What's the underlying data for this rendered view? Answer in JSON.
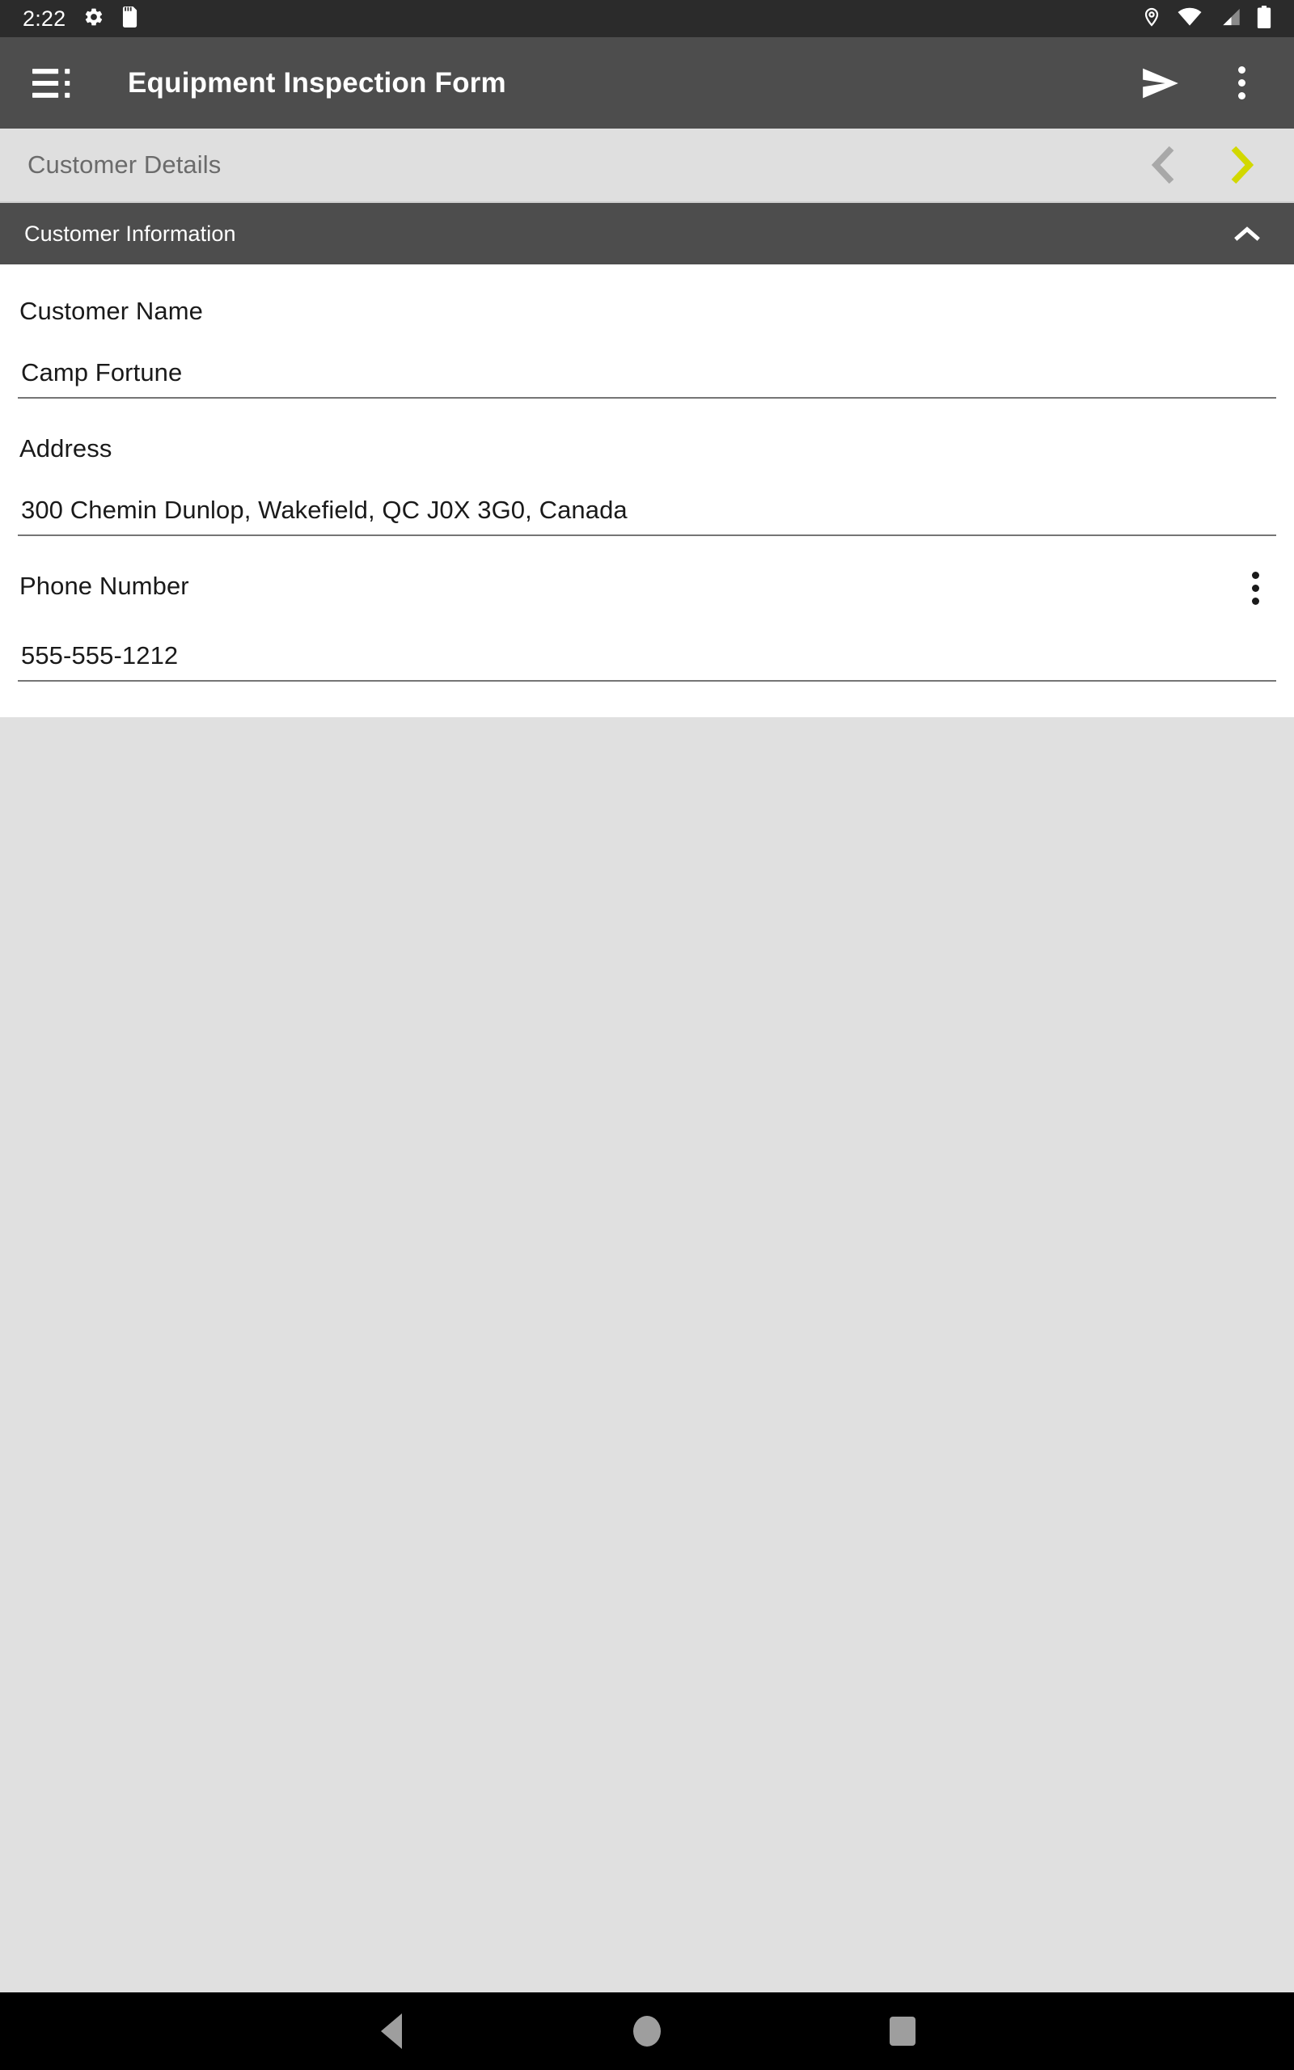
{
  "status_bar": {
    "time": "2:22",
    "left_icons": [
      "settings-gear-icon",
      "sd-card-icon"
    ],
    "right_icons": [
      "location-pin-icon",
      "wifi-icon",
      "cellular-signal-icon",
      "battery-icon"
    ],
    "background_color": "#2b2b2b"
  },
  "app_bar": {
    "menu_icon": "list-menu-icon",
    "title": "Equipment Inspection Form",
    "actions": [
      "send-icon",
      "overflow-menu-icon"
    ],
    "background_color": "#4d4d4d"
  },
  "page_nav": {
    "title": "Customer Details",
    "prev_label": "Previous page",
    "next_label": "Next page",
    "prev_enabled": false,
    "next_enabled": true,
    "prev_color": "#a8a8a8",
    "next_color": "#d2d800",
    "background_color": "#dfdfdf"
  },
  "section": {
    "title": "Customer Information",
    "expanded": true,
    "collapse_icon": "chevron-up-icon",
    "background_color": "#4d4d4d"
  },
  "form": {
    "fields": [
      {
        "label": "Customer Name",
        "value": "Camp Fortune",
        "placeholder": "",
        "has_menu": false
      },
      {
        "label": "Address",
        "value": "300 Chemin Dunlop, Wakefield, QC J0X 3G0, Canada",
        "placeholder": "",
        "has_menu": false
      },
      {
        "label": "Phone Number",
        "value": "555-555-1212",
        "placeholder": "",
        "has_menu": true,
        "menu_icon": "overflow-menu-icon"
      }
    ]
  },
  "nav_bar": {
    "back_label": "Back",
    "home_label": "Home",
    "recents_label": "Recent apps",
    "background_color": "#000000"
  }
}
